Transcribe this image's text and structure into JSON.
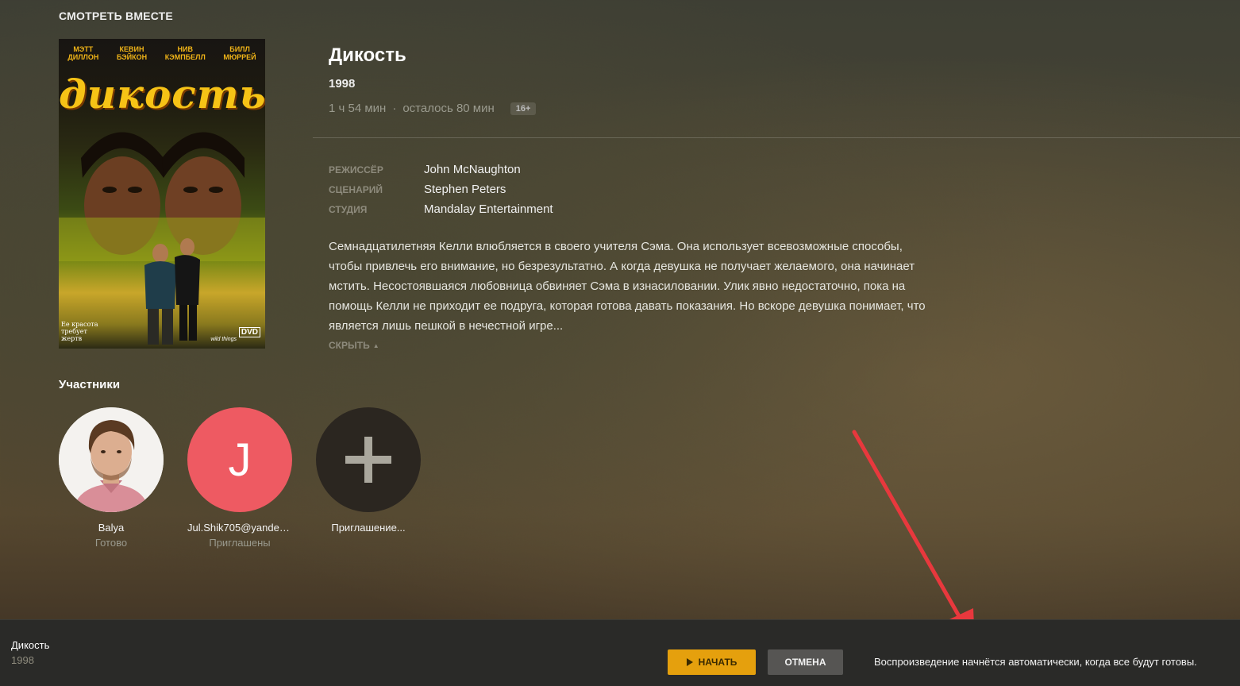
{
  "header": {
    "title": "СМОТРЕТЬ ВМЕСТЕ"
  },
  "poster": {
    "actors": [
      {
        "first": "МЭТТ",
        "last": "ДИЛЛОН"
      },
      {
        "first": "КЕВИН",
        "last": "БЭЙКОН"
      },
      {
        "first": "НИВ",
        "last": "КЭМПБЕЛЛ"
      },
      {
        "first": "БИЛЛ",
        "last": "МЮРРЕЙ"
      }
    ],
    "title": "дикость",
    "tagline_1": "Ее красота",
    "tagline_2": "требует",
    "tagline_3": "жертв",
    "logo_text": "wild things",
    "dvd": "DVD"
  },
  "movie": {
    "title": "Дикость",
    "year": "1998",
    "duration": "1 ч 54 мин",
    "separator": "·",
    "remaining": "осталось 80 мин",
    "rating": "16+",
    "credits": [
      {
        "label": "Режиссёр",
        "value": "John McNaughton"
      },
      {
        "label": "Сценарий",
        "value": "Stephen Peters"
      },
      {
        "label": "Студия",
        "value": "Mandalay Entertainment"
      }
    ],
    "summary": "Семнадцатилетняя Келли влюбляется в своего учителя Сэма. Она использует всевозможные способы, чтобы привлечь его внимание, но безрезультатно. А когда девушка не получает желаемого, она начинает мстить. Несостоявшаяся любовница обвиняет Сэма в изнасиловании. Улик явно недостаточно, пока на помощь Келли не приходит ее подруга, которая готова давать показания. Но вскоре девушка понимает, что является лишь пешкой в нечестной игре...",
    "collapse_label": "СКРЫТЬ"
  },
  "participants": {
    "title": "Участники",
    "items": [
      {
        "name": "Balya",
        "status": "Готово"
      },
      {
        "name": "Jul.Shik705@yandex...",
        "status": "Приглашены",
        "initial": "J"
      },
      {
        "name": "Приглашение...",
        "status": ""
      }
    ]
  },
  "footer": {
    "title": "Дикость",
    "year": "1998",
    "start_label": "НАЧАТЬ",
    "cancel_label": "ОТМЕНА",
    "info": "Воспроизведение начнётся автоматически, когда все будут готовы."
  },
  "colors": {
    "accent": "#e5a00d",
    "avatar_letter_bg": "#ee5a62",
    "arrow": "#e8383d"
  }
}
